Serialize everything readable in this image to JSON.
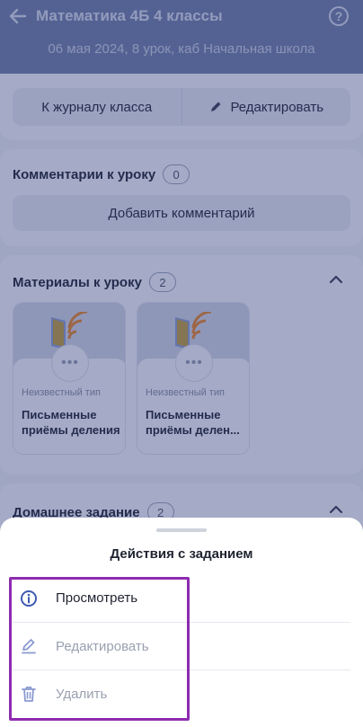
{
  "header": {
    "title": "Математика 4Б 4 классы",
    "subtitle": "06 мая 2024, 8 урок, каб Начальная школа",
    "help_symbol": "?"
  },
  "actions": {
    "journal_label": "К журналу класса",
    "edit_label": "Редактировать"
  },
  "comments": {
    "title": "Комментарии к уроку",
    "count": "0",
    "add_label": "Добавить комментарий"
  },
  "materials": {
    "title": "Материалы к уроку",
    "count": "2",
    "items": [
      {
        "type": "Неизвестный тип",
        "name_line1": "Письменные",
        "name_line2": "приёмы деления"
      },
      {
        "type": "Неизвестный тип",
        "name_line1": "Письменные",
        "name_line2": "приёмы делен..."
      }
    ]
  },
  "homework": {
    "title": "Домашнее задание",
    "count": "2"
  },
  "sheet": {
    "title": "Действия с заданием",
    "items": [
      {
        "label": "Просмотреть",
        "icon": "info-icon",
        "enabled": true
      },
      {
        "label": "Редактировать",
        "icon": "pencil-icon",
        "enabled": false
      },
      {
        "label": "Удалить",
        "icon": "trash-icon",
        "enabled": false
      }
    ]
  },
  "colors": {
    "header_bg": "#7482a8",
    "accent": "#3f5bb0",
    "highlight_border": "#8e2bb0",
    "disabled_text": "#9aa0b0"
  }
}
